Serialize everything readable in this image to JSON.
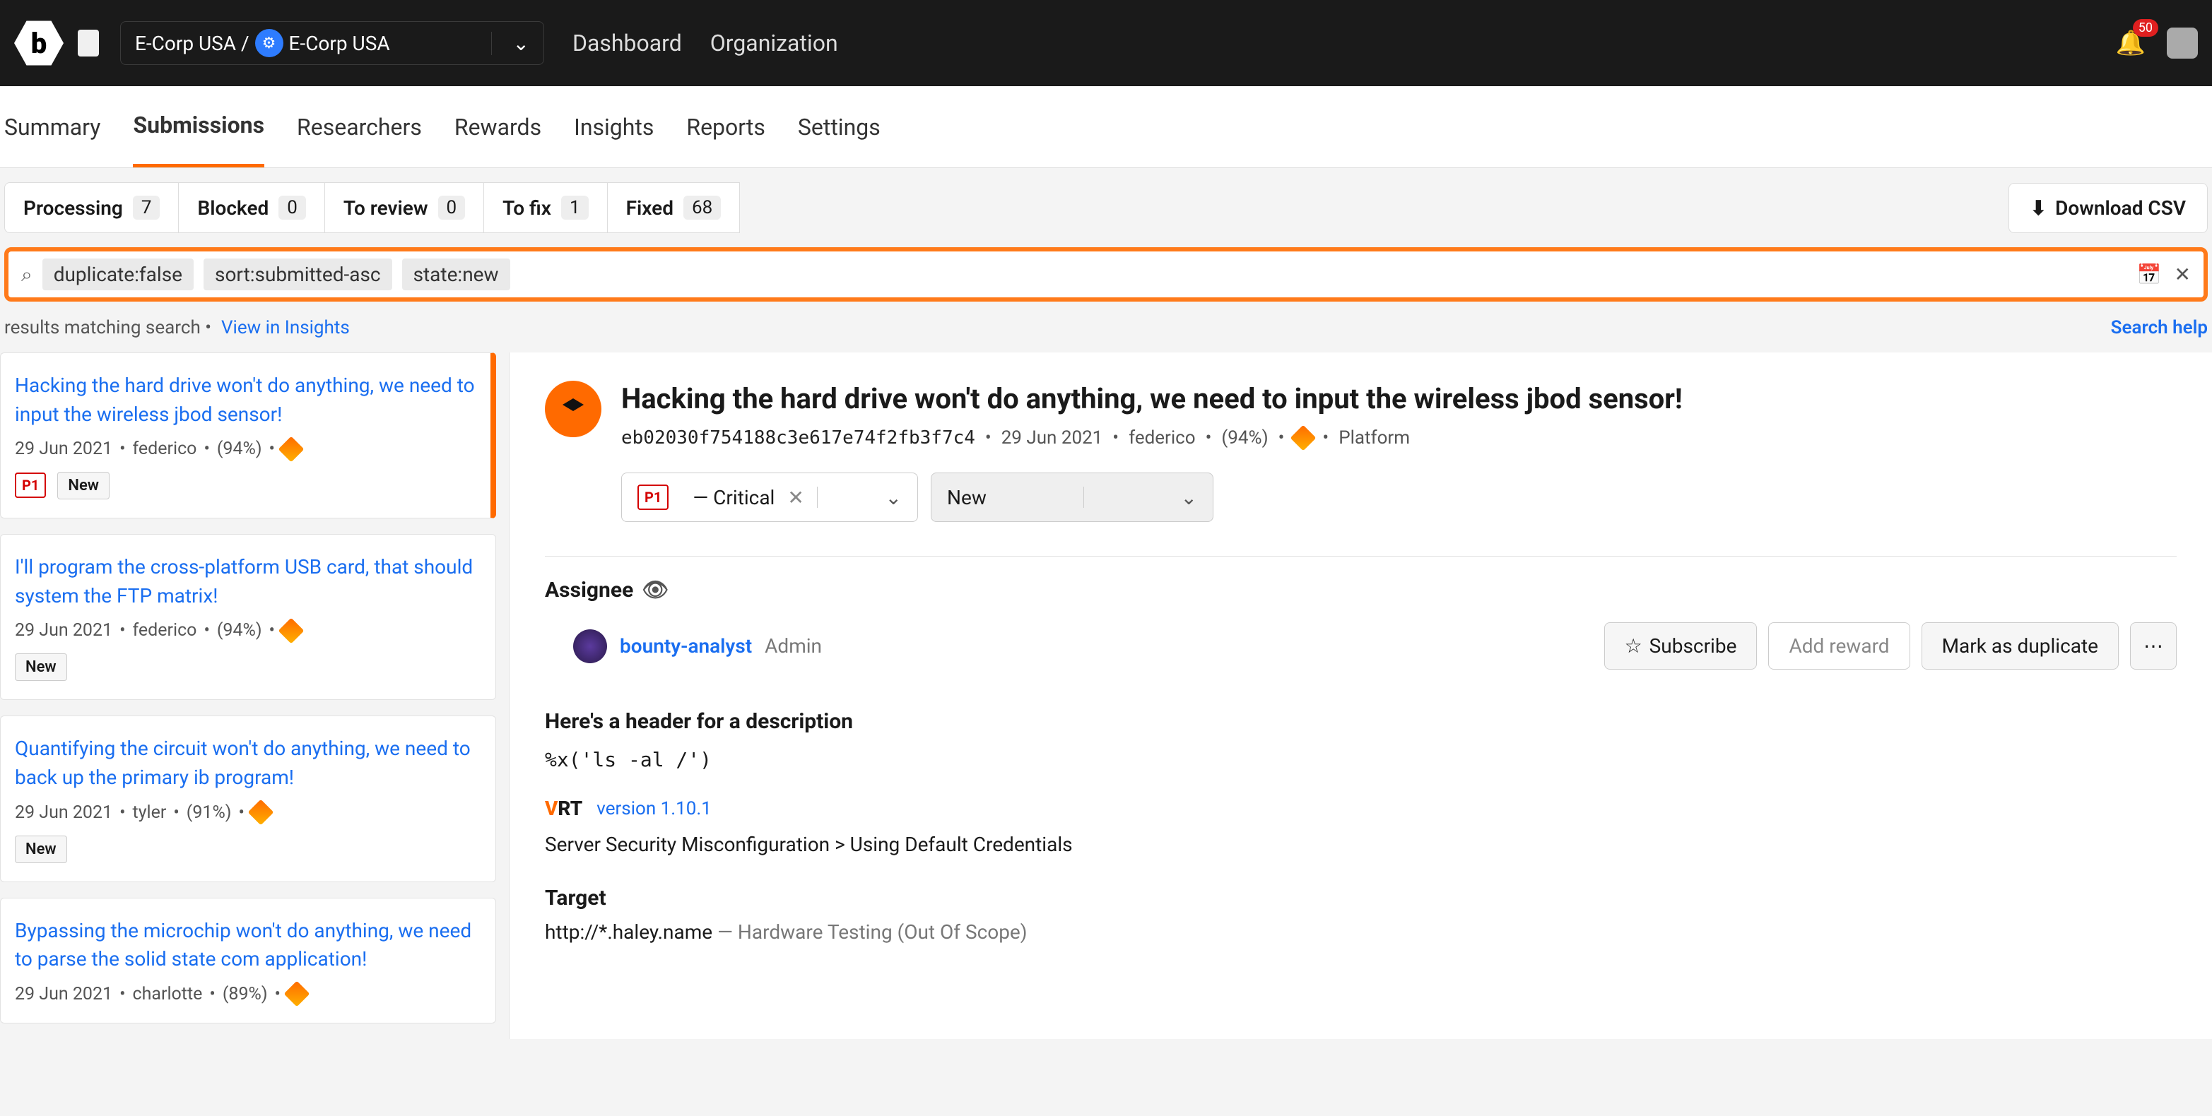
{
  "topbar": {
    "breadcrumb_org": "E-Corp USA /",
    "breadcrumb_current": "E-Corp USA",
    "nav": {
      "dashboard": "Dashboard",
      "organization": "Organization"
    },
    "notification_count": "50"
  },
  "tabs": {
    "summary": "Summary",
    "submissions": "Submissions",
    "researchers": "Researchers",
    "rewards": "Rewards",
    "insights": "Insights",
    "reports": "Reports",
    "settings": "Settings"
  },
  "filters": {
    "processing": {
      "label": "Processing",
      "count": "7"
    },
    "blocked": {
      "label": "Blocked",
      "count": "0"
    },
    "to_review": {
      "label": "To review",
      "count": "0"
    },
    "to_fix": {
      "label": "To fix",
      "count": "1"
    },
    "fixed": {
      "label": "Fixed",
      "count": "68"
    },
    "download": "Download CSV"
  },
  "search": {
    "chips": [
      "duplicate:false",
      "sort:submitted-asc",
      "state:new"
    ]
  },
  "resultsbar": {
    "text": "results matching search  •",
    "view_insights": "View in Insights",
    "search_help": "Search help"
  },
  "cards": [
    {
      "title": "Hacking the hard drive won't do anything, we need to input the wireless jbod sensor!",
      "date": "29 Jun 2021",
      "author": "federico",
      "pct": "(94%)",
      "priority": "P1",
      "status": "New",
      "active": true
    },
    {
      "title": "I'll program the cross-platform USB card, that should system the FTP matrix!",
      "date": "29 Jun 2021",
      "author": "federico",
      "pct": "(94%)",
      "status": "New"
    },
    {
      "title": "Quantifying the circuit won't do anything, we need to back up the primary ib program!",
      "date": "29 Jun 2021",
      "author": "tyler",
      "pct": "(91%)",
      "status": "New"
    },
    {
      "title": "Bypassing the microchip won't do anything, we need to parse the solid state com application!",
      "date": "29 Jun 2021",
      "author": "charlotte",
      "pct": "(89%)"
    }
  ],
  "detail": {
    "title": "Hacking the hard drive won't do anything, we need to input the wireless jbod sensor!",
    "hash": "eb02030f754188c3e617e74f2fb3f7c4",
    "date": "29 Jun 2021",
    "author": "federico",
    "pct": "(94%)",
    "platform": "Platform",
    "priority_badge": "P1",
    "priority_label": "— Critical",
    "state": "New",
    "assignee_label": "Assignee",
    "assignee_name": "bounty-analyst",
    "assignee_role": "Admin",
    "subscribe": "Subscribe",
    "add_reward": "Add reward",
    "mark_duplicate": "Mark as duplicate",
    "desc_header": "Here's a header for a description",
    "desc_code": "%x('ls -al /')",
    "vrt_label": "VRT",
    "vrt_version": "version 1.10.1",
    "vrt_path": "Server Security Misconfiguration > Using Default Credentials",
    "target_label": "Target",
    "target_url": "http://*.haley.name",
    "target_scope": " — Hardware Testing (Out Of Scope)"
  }
}
